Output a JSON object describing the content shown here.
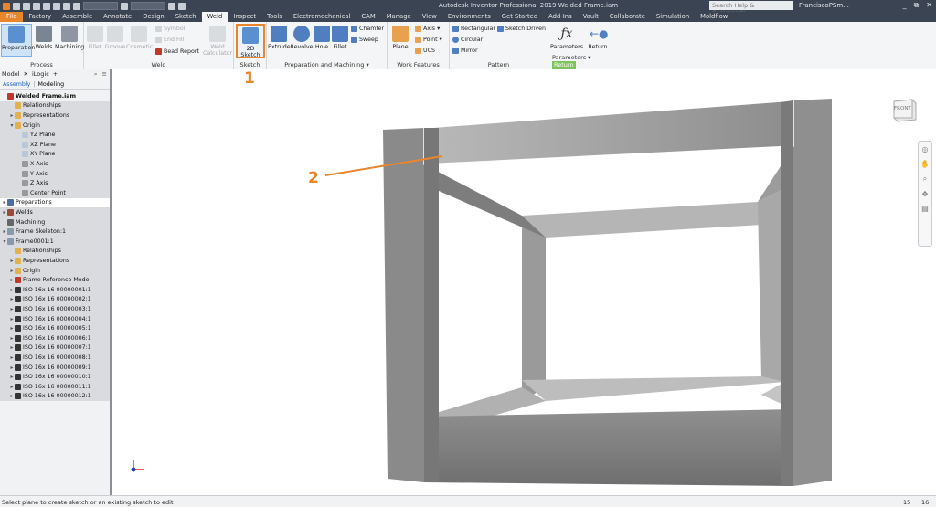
{
  "titlebar": {
    "title": "Autodesk Inventor Professional 2019   Welded Frame.iam",
    "search_placeholder": "Search Help & Commands...",
    "user": "FranciscoPSm...",
    "minimize": "_",
    "restore": "⧉",
    "close": "✕"
  },
  "tabs": [
    "File",
    "Factory",
    "Assemble",
    "Annotate",
    "Design",
    "Sketch",
    "Weld",
    "Inspect",
    "Tools",
    "Electromechanical",
    "CAM",
    "Manage",
    "View",
    "Environments",
    "Get Started",
    "Add-Ins",
    "Vault",
    "Collaborate",
    "Simulation",
    "Moldflow"
  ],
  "ribbon": {
    "process": {
      "title": "Process",
      "preparation": "Preparation",
      "welds": "Welds",
      "machining": "Machining"
    },
    "weld": {
      "title": "Weld",
      "fillet": "Fillet",
      "groove": "Groove",
      "cosmetic": "Cosmetic",
      "symbol": "Symbol",
      "end_fill": "End Fill",
      "bead_report": "Bead Report",
      "weld_calculator": "Weld Calculator"
    },
    "sketch": {
      "title": "Sketch",
      "sketch2d": "2D Sketch"
    },
    "prep_machining": {
      "title": "Preparation and Machining ▾",
      "extrude": "Extrude",
      "revolve": "Revolve",
      "hole": "Hole",
      "fillet": "Fillet",
      "chamfer": "Chamfer",
      "sweep": "Sweep"
    },
    "work_features": {
      "title": "Work Features",
      "plane": "Plane",
      "axis": "Axis ▾",
      "point": "Point ▾",
      "ucs": "UCS"
    },
    "pattern": {
      "title": "Pattern",
      "rectangular": "Rectangular",
      "circular": "Circular",
      "mirror": "Mirror",
      "sketch_driven": "Sketch Driven"
    },
    "parameters": {
      "title": "Parameters ▾",
      "parameters": "Parameters",
      "return": "Return",
      "return_badge": "Return"
    }
  },
  "browser": {
    "tab_model": "Model",
    "tab_ilogic": "iLogic",
    "sub_assembly": "Assembly",
    "sub_modeling": "Modeling",
    "nodes": [
      {
        "label": "Welded Frame.iam",
        "indent": 0,
        "exp": "",
        "color": "#c0392b",
        "bold": true,
        "shade": false
      },
      {
        "label": "Relationships",
        "indent": 1,
        "exp": "",
        "color": "#e3b14c",
        "shade": true
      },
      {
        "label": "Representations",
        "indent": 1,
        "exp": "▸",
        "color": "#e3b14c",
        "shade": true
      },
      {
        "label": "Origin",
        "indent": 1,
        "exp": "▾",
        "color": "#e3b14c",
        "shade": true
      },
      {
        "label": "YZ Plane",
        "indent": 2,
        "exp": "",
        "color": "#b8c7d9",
        "shade": true
      },
      {
        "label": "XZ Plane",
        "indent": 2,
        "exp": "",
        "color": "#b8c7d9",
        "shade": true
      },
      {
        "label": "XY Plane",
        "indent": 2,
        "exp": "",
        "color": "#b8c7d9",
        "shade": true
      },
      {
        "label": "X Axis",
        "indent": 2,
        "exp": "",
        "color": "#999",
        "shade": true
      },
      {
        "label": "Y Axis",
        "indent": 2,
        "exp": "",
        "color": "#999",
        "shade": true
      },
      {
        "label": "Z Axis",
        "indent": 2,
        "exp": "",
        "color": "#999",
        "shade": true
      },
      {
        "label": "Center Point",
        "indent": 2,
        "exp": "",
        "color": "#999",
        "shade": true
      },
      {
        "label": "Preparations",
        "indent": 0,
        "exp": "▸",
        "color": "#4a6fa5",
        "sel": true
      },
      {
        "label": "Welds",
        "indent": 0,
        "exp": "▸",
        "color": "#9b4a3a",
        "shade": true
      },
      {
        "label": "Machining",
        "indent": 0,
        "exp": "",
        "color": "#666",
        "shade": true
      },
      {
        "label": "Frame Skeleton:1",
        "indent": 0,
        "exp": "▸",
        "color": "#8899aa",
        "shade": true
      },
      {
        "label": "Frame0001:1",
        "indent": 0,
        "exp": "▾",
        "color": "#8899aa",
        "shade": true
      },
      {
        "label": "Relationships",
        "indent": 1,
        "exp": "",
        "color": "#e3b14c",
        "shade": true
      },
      {
        "label": "Representations",
        "indent": 1,
        "exp": "▸",
        "color": "#e3b14c",
        "shade": true
      },
      {
        "label": "Origin",
        "indent": 1,
        "exp": "▸",
        "color": "#e3b14c",
        "shade": true
      },
      {
        "label": "Frame Reference Model",
        "indent": 1,
        "exp": "▸",
        "color": "#c0392b",
        "shade": true
      },
      {
        "label": "ISO 16x 16 00000001:1",
        "indent": 1,
        "exp": "▸",
        "color": "#333",
        "shade": true
      },
      {
        "label": "ISO 16x 16 00000002:1",
        "indent": 1,
        "exp": "▸",
        "color": "#333",
        "shade": true
      },
      {
        "label": "ISO 16x 16 00000003:1",
        "indent": 1,
        "exp": "▸",
        "color": "#333",
        "shade": true
      },
      {
        "label": "ISO 16x 16 00000004:1",
        "indent": 1,
        "exp": "▸",
        "color": "#333",
        "shade": true
      },
      {
        "label": "ISO 16x 16 00000005:1",
        "indent": 1,
        "exp": "▸",
        "color": "#333",
        "shade": true
      },
      {
        "label": "ISO 16x 16 00000006:1",
        "indent": 1,
        "exp": "▸",
        "color": "#333",
        "shade": true
      },
      {
        "label": "ISO 16x 16 00000007:1",
        "indent": 1,
        "exp": "▸",
        "color": "#333",
        "shade": true
      },
      {
        "label": "ISO 16x 16 00000008:1",
        "indent": 1,
        "exp": "▸",
        "color": "#333",
        "shade": true
      },
      {
        "label": "ISO 16x 16 00000009:1",
        "indent": 1,
        "exp": "▸",
        "color": "#333",
        "shade": true
      },
      {
        "label": "ISO 16x 16 00000010:1",
        "indent": 1,
        "exp": "▸",
        "color": "#333",
        "shade": true
      },
      {
        "label": "ISO 16x 16 00000011:1",
        "indent": 1,
        "exp": "▸",
        "color": "#333",
        "shade": true
      },
      {
        "label": "ISO 16x 16 00000012:1",
        "indent": 1,
        "exp": "▸",
        "color": "#333",
        "shade": true
      }
    ]
  },
  "viewcube": {
    "face": "FRONT"
  },
  "annotations": {
    "one": "1",
    "two": "2",
    "color": "#e8862b"
  },
  "status": {
    "message": "Select plane to create sketch or an existing sketch to edit",
    "count1": "15",
    "count2": "16"
  },
  "colors": {
    "ribbon_dark": "#3b4453",
    "accent": "#e8862b",
    "highlight": "#cfe3f7"
  }
}
